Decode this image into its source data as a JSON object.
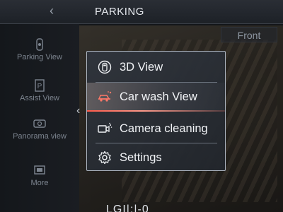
{
  "header": {
    "title": "PARKING",
    "back_icon": "chevron-left-icon"
  },
  "camera": {
    "direction_label": "Front"
  },
  "sidebar": {
    "items": [
      {
        "label": "Parking View",
        "icon": "parking-car-icon"
      },
      {
        "label": "Assist View",
        "icon": "parking-p-icon"
      },
      {
        "label": "Panorama view",
        "icon": "panorama-icon"
      },
      {
        "label": "More",
        "icon": "more-camera-icon"
      }
    ]
  },
  "menu": {
    "items": [
      {
        "label": "3D View",
        "icon": "car-3d-icon",
        "selected": false
      },
      {
        "label": "Car wash View",
        "icon": "car-wash-icon",
        "selected": true
      },
      {
        "label": "Camera cleaning",
        "icon": "camera-clean-icon",
        "selected": false
      },
      {
        "label": "Settings",
        "icon": "gear-icon",
        "selected": false
      }
    ]
  },
  "colors": {
    "accent": "#ff5a4a",
    "menu_border": "#aeb6c2"
  },
  "bottom_partial_text": "LGI|:|-0"
}
